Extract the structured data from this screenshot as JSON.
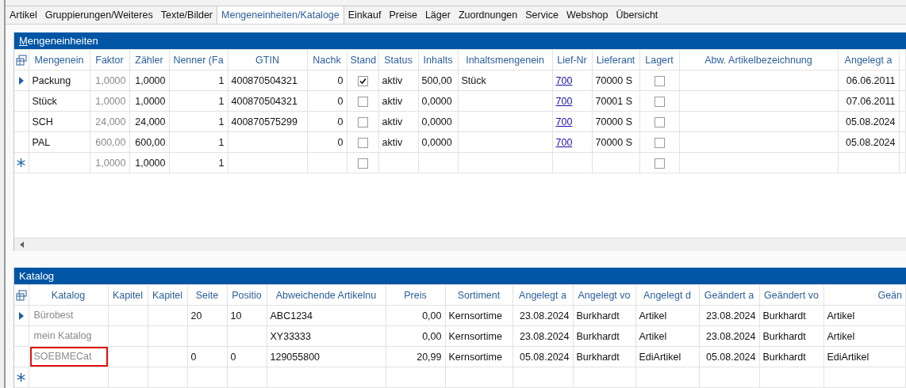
{
  "tabs": [
    {
      "label": "Artikel",
      "selected": false
    },
    {
      "label": "Gruppierungen/Weiteres",
      "selected": false
    },
    {
      "label": "Texte/Bilder",
      "selected": false
    },
    {
      "label": "Mengeneinheiten/Kataloge",
      "selected": true
    },
    {
      "label": "Einkauf",
      "selected": false
    },
    {
      "label": "Preise",
      "selected": false
    },
    {
      "label": "Läger",
      "selected": false
    },
    {
      "label": "Zuordnungen",
      "selected": false
    },
    {
      "label": "Service",
      "selected": false
    },
    {
      "label": "Webshop",
      "selected": false
    },
    {
      "label": "Übersicht",
      "selected": false
    }
  ],
  "units": {
    "title": "Mengeneinheiten",
    "mnemonic_underlined": true,
    "columns": [
      {
        "label": "Mengenein",
        "kind": "text"
      },
      {
        "label": "Faktor",
        "kind": "muted-number"
      },
      {
        "label": "Zähler",
        "kind": "number"
      },
      {
        "label": "Nenner (Fa",
        "kind": "number"
      },
      {
        "label": "GTIN",
        "kind": "text"
      },
      {
        "label": "Nachk",
        "kind": "number"
      },
      {
        "label": "Stand",
        "kind": "check"
      },
      {
        "label": "Status",
        "kind": "text"
      },
      {
        "label": "Inhalts",
        "kind": "text"
      },
      {
        "label": "Inhaltsmengenein",
        "kind": "text"
      },
      {
        "label": "Lief-Nr",
        "kind": "link"
      },
      {
        "label": "Lieferant",
        "kind": "text"
      },
      {
        "label": "Lagert",
        "kind": "check"
      },
      {
        "label": "Abw. Artikelbezeichnung",
        "kind": "text"
      },
      {
        "label": "Angelegt a",
        "kind": "number"
      },
      {
        "kind": "text"
      }
    ],
    "rows": [
      {
        "kind": "data",
        "current": true,
        "cells": [
          "Packung",
          "1,0000",
          "1,0000",
          "1",
          "400870504321",
          "0",
          {
            "checked": true
          },
          "aktiv",
          "500,00",
          "Stück",
          "700",
          "70000 S",
          {
            "checked": false
          },
          null,
          "06.06.2011",
          null
        ]
      },
      {
        "kind": "data",
        "current": false,
        "cells": [
          "Stück",
          "1,0000",
          "1,0000",
          "1",
          "400870504321",
          "0",
          {
            "checked": false
          },
          "aktiv",
          "0,0000",
          null,
          "700",
          "70001 S",
          {
            "checked": false
          },
          null,
          "07.06.2011",
          null
        ]
      },
      {
        "kind": "data",
        "current": false,
        "cells": [
          "SCH",
          "24,000",
          "24,000",
          "1",
          "400870575299",
          "0",
          {
            "checked": false
          },
          "aktiv",
          "0,0000",
          null,
          "700",
          "70000 S",
          {
            "checked": false
          },
          null,
          "05.08.2024",
          null
        ]
      },
      {
        "kind": "data",
        "current": false,
        "cells": [
          "PAL",
          "600,00",
          "600,00",
          "1",
          null,
          "0",
          {
            "checked": false
          },
          "aktiv",
          "0,0000",
          null,
          "700",
          "70000 S",
          {
            "checked": false
          },
          null,
          "05.08.2024",
          null
        ]
      },
      {
        "kind": "new",
        "current": false,
        "cells": [
          null,
          "1,0000",
          "1,0000",
          "1",
          null,
          null,
          {
            "checked": false
          },
          null,
          null,
          null,
          null,
          null,
          {
            "checked": false
          },
          null,
          null,
          null
        ]
      }
    ]
  },
  "catalog": {
    "title": "Katalog",
    "columns": [
      {
        "label": "Katalog",
        "kind": "muted"
      },
      {
        "label": "Kapitel",
        "kind": "text"
      },
      {
        "label": "Kapitel",
        "kind": "text"
      },
      {
        "label": "Seite",
        "kind": "text"
      },
      {
        "label": "Positio",
        "kind": "text"
      },
      {
        "label": "Abweichende Artikelnu",
        "kind": "text"
      },
      {
        "label": "Preis",
        "kind": "number"
      },
      {
        "label": "Sortiment",
        "kind": "text"
      },
      {
        "label": "Angelegt a",
        "kind": "number"
      },
      {
        "label": "Angelegt vo",
        "kind": "text"
      },
      {
        "label": "Angelegt d",
        "kind": "text"
      },
      {
        "label": "Geändert a",
        "kind": "number"
      },
      {
        "label": "Geändert vo",
        "kind": "text"
      },
      {
        "label": "Geän",
        "kind": "text"
      }
    ],
    "rows": [
      {
        "kind": "data",
        "current": true,
        "highlighted": false,
        "cells": [
          "Bürobest",
          null,
          null,
          "20",
          "10",
          "ABC1234",
          "0,00",
          "Kernsortime",
          "23.08.2024",
          "Burkhardt",
          "Artikel",
          "23.08.2024",
          "Burkhardt",
          "Artikel"
        ]
      },
      {
        "kind": "data",
        "current": false,
        "highlighted": false,
        "cells": [
          "mein Katalog",
          null,
          null,
          null,
          null,
          "XY33333",
          "0,00",
          "Kernsortime",
          "23.08.2024",
          "Burkhardt",
          "Artikel",
          "23.08.2024",
          "Burkhardt",
          "Artikel"
        ]
      },
      {
        "kind": "data",
        "current": false,
        "highlighted": true,
        "cells": [
          "SOEBMECat",
          null,
          null,
          "0",
          "0",
          "129055800",
          "20,99",
          "Kernsortime",
          "05.08.2024",
          "Burkhardt",
          "EdiArtikel",
          "05.08.2024",
          "Burkhardt",
          "EdiArtikel"
        ]
      },
      {
        "kind": "new",
        "current": false,
        "highlighted": false,
        "cells": [
          null,
          null,
          null,
          null,
          null,
          null,
          null,
          null,
          null,
          null,
          null,
          null,
          null,
          null
        ]
      }
    ]
  }
}
